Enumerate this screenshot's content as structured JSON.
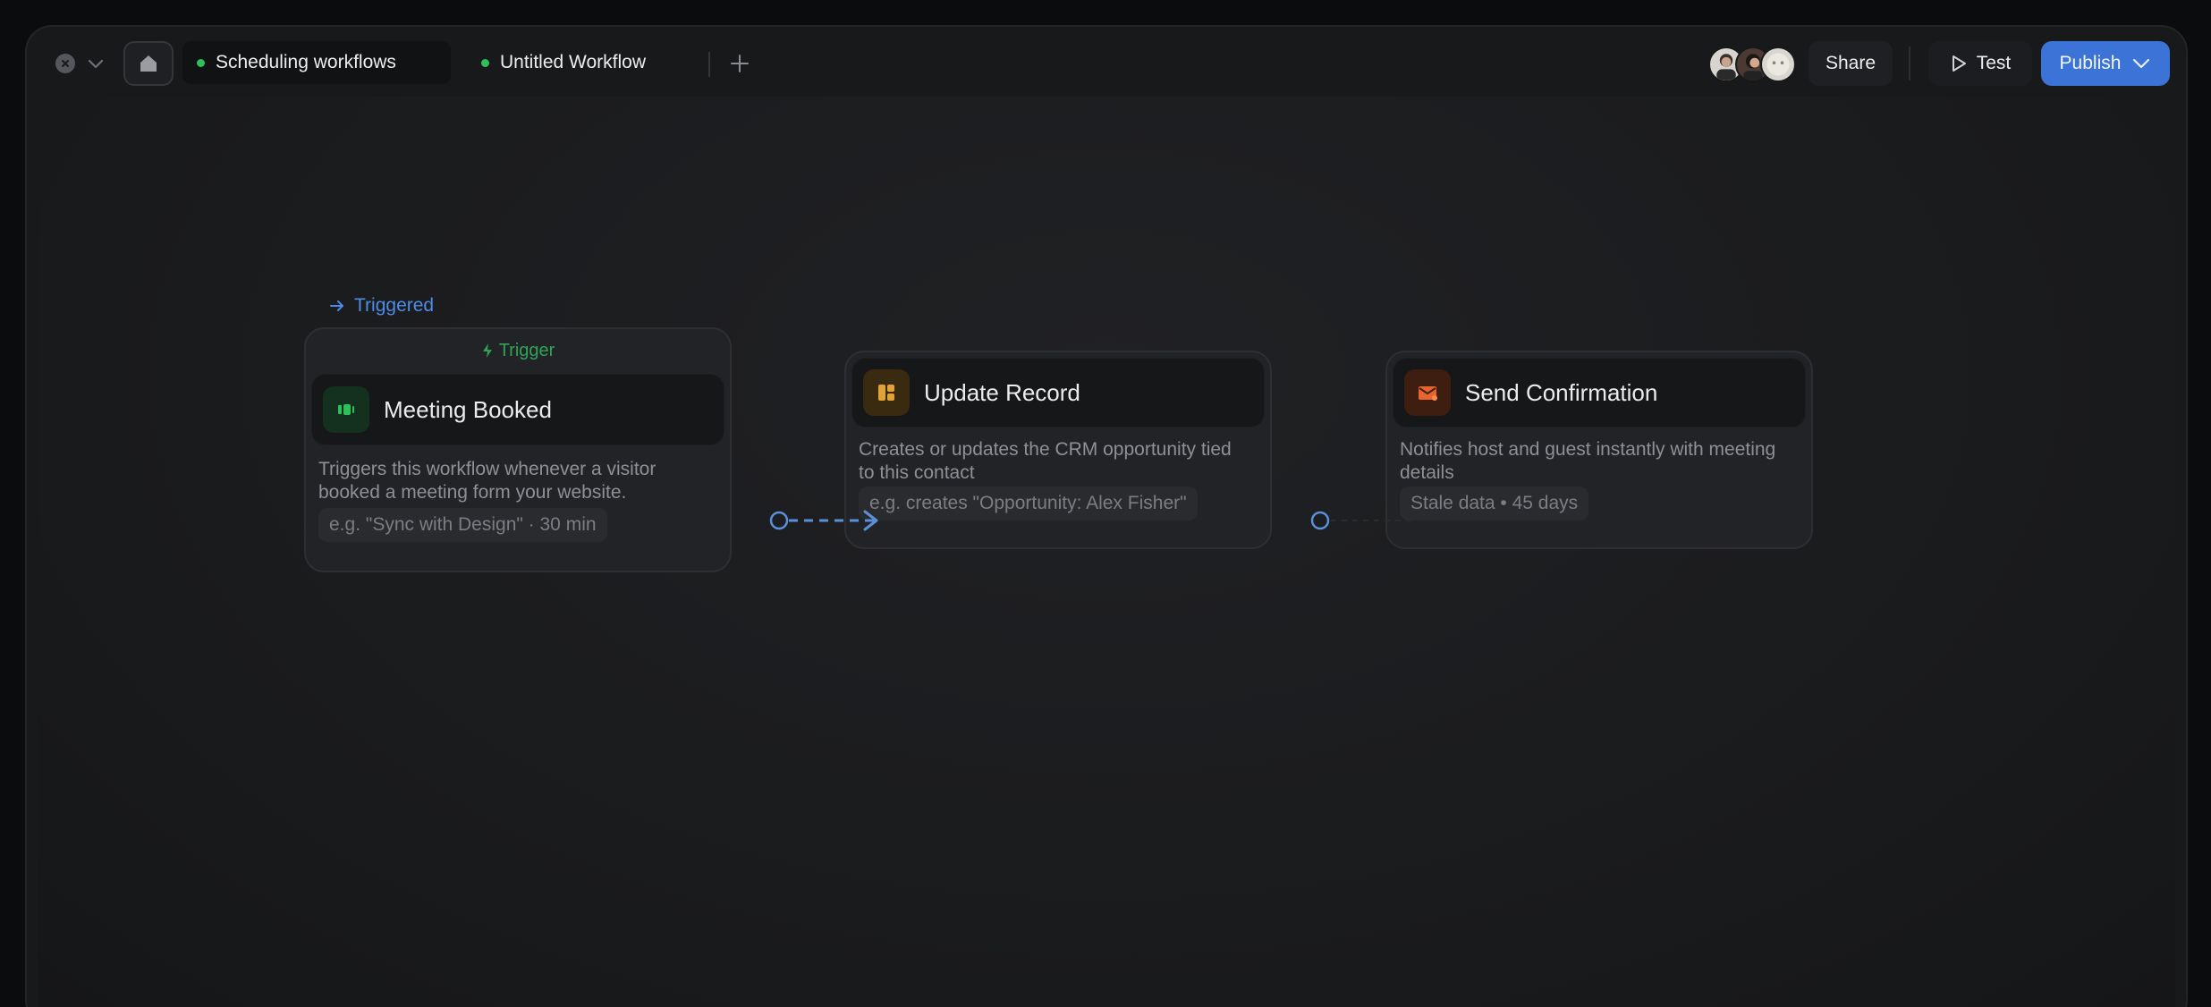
{
  "tabs": [
    {
      "label": "Scheduling workflows",
      "active": true,
      "status_color": "#2fbf5a"
    },
    {
      "label": "Untitled Workflow",
      "active": false,
      "status_color": "#2fbf5a"
    }
  ],
  "toolbar": {
    "share_label": "Share",
    "test_label": "Test",
    "publish_label": "Publish"
  },
  "flow": {
    "triggered_label": "Triggered",
    "trigger_card": {
      "header": "Trigger",
      "title": "Meeting Booked",
      "description": "Triggers this workflow whenever a visitor booked a meeting form your website.",
      "example": "e.g. \"Sync with Design\" · 30 min",
      "icon": "meeting-icon"
    },
    "update_card": {
      "title": "Update Record",
      "description": "Creates or updates the CRM opportunity tied to this contact",
      "example": "e.g. creates \"Opportunity: Alex Fisher\"",
      "icon": "table-icon"
    },
    "send_card": {
      "title": "Send Confirmation",
      "description": "Notifies host and guest instantly with meeting details",
      "example": "Stale data • 45 days",
      "icon": "mail-icon"
    }
  },
  "colors": {
    "accent": "#3b74d6",
    "connector": "#4d8ce8",
    "trigger_green": "#2fa356"
  }
}
